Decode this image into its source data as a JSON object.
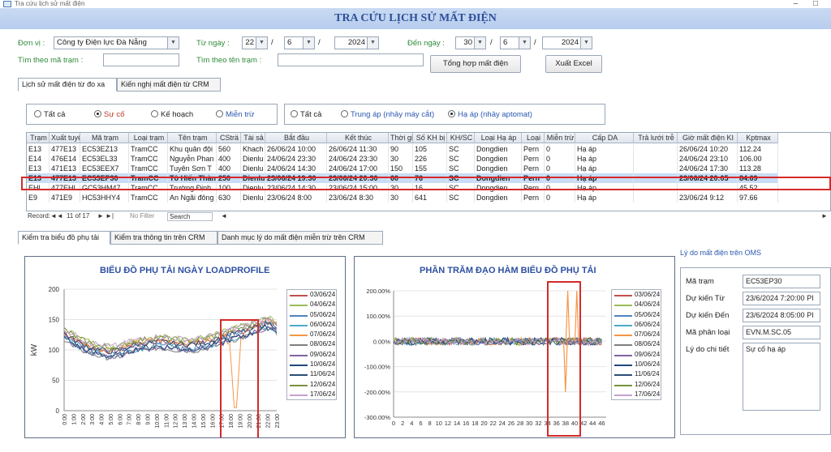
{
  "window": {
    "title": "Tra cứu lịch sử mất điện",
    "controls": "–  □"
  },
  "banner_title": "TRA CỨU LỊCH SỬ MẤT ĐIỆN",
  "filters": {
    "unit_label": "Đơn vị :",
    "unit_value": "Công ty Điện lực Đà Nẵng",
    "from_label": "Từ ngày :",
    "from_day": "22",
    "from_month": "6",
    "from_year": "2024",
    "to_label": "Đến ngày :",
    "to_day": "30",
    "to_month": "6",
    "to_year": "2024",
    "slash": "/",
    "search_code_label": "Tìm theo mã trạm :",
    "search_name_label": "Tìm theo tên trạm :",
    "search_code_value": "",
    "search_name_value": ""
  },
  "buttons": {
    "summary": "Tổng hợp mất điện",
    "export": "Xuất Excel"
  },
  "top_tabs": [
    "Lịch sử mất điện từ đo xa",
    "Kiến nghị mất điện từ CRM"
  ],
  "radios_group1": [
    {
      "label": "Tất cả",
      "checked": false,
      "color": "#222222"
    },
    {
      "label": "Sự cố",
      "checked": true,
      "color": "#c0392b"
    },
    {
      "label": "Kế hoạch",
      "checked": false,
      "color": "#222222"
    },
    {
      "label": "Miễn trừ",
      "checked": false,
      "color": "#2a58b0"
    }
  ],
  "radios_group2": [
    {
      "label": "Tất cả",
      "checked": false,
      "color": "#222222"
    },
    {
      "label": "Trung áp (nhảy máy cắt)",
      "checked": false,
      "color": "#2a58b0"
    },
    {
      "label": "Hạ áp (nhảy aptomat)",
      "checked": true,
      "color": "#2a58b0"
    }
  ],
  "table": {
    "columns": [
      "Trạm",
      "Xuất tuyế",
      "Mã trạm",
      "Loại trạm",
      "Tên trạm",
      "CSträ",
      "Tài sả",
      "Bắt đầu",
      "Kết thúc",
      "Thời gi",
      "Số KH bị",
      "KH/SC",
      "Loại Hạ áp",
      "Loại",
      "Miễn trừ",
      "Cấp DA",
      "Trả lưới trễ",
      "Giờ mất điện KI",
      "Kptmax"
    ],
    "rows": [
      [
        "E13",
        "477E13",
        "EC53EZ13",
        "TramCC",
        "Khu quân đội",
        "560",
        "Khach",
        "26/06/24 10:00",
        "26/06/24 11:30",
        "90",
        "105",
        "SC",
        "Dongdien",
        "Pern",
        "0",
        "Hạ áp",
        "",
        "26/06/24 10:20",
        "112.24"
      ],
      [
        "E14",
        "476E14",
        "EC53EL33",
        "TramCC",
        "Nguyễn Phan",
        "400",
        "Dienlu",
        "24/06/24 23:30",
        "24/06/24 23:30",
        "30",
        "226",
        "SC",
        "Dongdien",
        "Pern",
        "0",
        "Hạ áp",
        "",
        "24/06/24 23:10",
        "106.00"
      ],
      [
        "E13",
        "471E13",
        "EC53EEX7",
        "TramCC",
        "Tuyên Sơn T",
        "400",
        "Dienlu",
        "24/06/24 14:30",
        "24/06/24 17:00",
        "150",
        "155",
        "SC",
        "Dongdien",
        "Pern",
        "0",
        "Hạ áp",
        "",
        "24/06/24 17:30",
        "113.28"
      ],
      [
        "E13",
        "477E13",
        "EC53EP30",
        "TramCC",
        "Tô Hiến Thàn",
        "250",
        "Dienlu",
        "23/06/24 19:30",
        "23/06/24 20:30",
        "60",
        "76",
        "SC",
        "Dongdien",
        "Pern",
        "0",
        "Hạ áp",
        "",
        "23/06/24 20:05",
        "84.69"
      ],
      [
        "EHL",
        "477EHL",
        "GC53HM47",
        "TramCC",
        "Trường Định",
        "100",
        "Dienlu",
        "23/06/24 14:30",
        "23/06/24 15:00",
        "30",
        "16",
        "SC",
        "Dongdien",
        "Pern",
        "0",
        "Hạ áp",
        "",
        "",
        "45.52"
      ],
      [
        "E9",
        "471E9",
        "HC53HHY4",
        "TramCC",
        "An Ngãi đông",
        "630",
        "Dienlu",
        "23/06/24 8:00",
        "23/06/24 8:30",
        "30",
        "641",
        "SC",
        "Dongdien",
        "Pern",
        "0",
        "Hạ áp",
        "",
        "23/06/24 9:12",
        "97.66"
      ]
    ],
    "selected_row": 3
  },
  "record_nav": {
    "label": "Record:",
    "position": "11 of 17",
    "filter": "No Filter",
    "search": "Search"
  },
  "bottom_tabs": [
    "Kiểm tra biểu đồ phụ tải",
    "Kiểm tra thông tin trên CRM",
    "Danh mục lý do mất điện miễn trừ trên CRM"
  ],
  "legend_dates": [
    "03/06/24",
    "04/06/24",
    "05/06/24",
    "06/06/24",
    "07/06/24",
    "08/06/24",
    "09/06/24",
    "10/06/24",
    "11/06/24",
    "12/06/24",
    "17/06/24"
  ],
  "series_colors": [
    "#c0504d",
    "#9bbb59",
    "#4f81bd",
    "#4bacc6",
    "#f79646",
    "#7f7f7f",
    "#8064a2",
    "#1f497d",
    "#2c4d75",
    "#77933c",
    "#c6a0d0"
  ],
  "chart_data": [
    {
      "type": "line",
      "title": "BIỂU ĐỒ PHỤ TẢI NGÀY LOADPROFILE",
      "ylabel": "kW",
      "ylim": [
        0,
        200
      ],
      "yticks": [
        0,
        50,
        100,
        150,
        200
      ],
      "x": [
        "0:00",
        "1:00",
        "2:00",
        "3:00",
        "4:00",
        "5:00",
        "6:00",
        "7:00",
        "8:00",
        "9:00",
        "10:00",
        "11:00",
        "12:00",
        "13:00",
        "14:00",
        "15:00",
        "16:00",
        "17:00",
        "18:00",
        "19:00",
        "20:00",
        "21:00",
        "22:00",
        "23:00"
      ],
      "series_count": 11,
      "typical_profile": [
        128,
        118,
        110,
        104,
        100,
        98,
        100,
        106,
        110,
        112,
        114,
        113,
        111,
        110,
        110,
        112,
        116,
        120,
        126,
        130,
        134,
        140,
        145,
        140
      ],
      "outage": {
        "series": "07/06/24",
        "values": [
          126,
          110,
          60,
          5,
          60,
          120
        ]
      }
    },
    {
      "type": "line",
      "title": "PHẦN TRĂM ĐẠO HÀM BIỂU ĐỒ PHỤ TẢI",
      "ylim": [
        -300,
        200
      ],
      "yticks": [
        "200.00%",
        "100.00%",
        "0.00%",
        "-100.00%",
        "-200.00%",
        "-300.00%"
      ],
      "x": [
        "0",
        "2",
        "4",
        "6",
        "8",
        "10",
        "12",
        "14",
        "16",
        "18",
        "20",
        "22",
        "24",
        "26",
        "28",
        "30",
        "32",
        "34",
        "36",
        "38",
        "40",
        "42",
        "44",
        "46"
      ],
      "series_count": 11,
      "baseline": 0,
      "spikes": [
        {
          "series": "07/06/24",
          "x": 38,
          "y": -200
        },
        {
          "series": "07/06/24",
          "x": 38.5,
          "y": 200
        },
        {
          "series": "07/06/24",
          "x": 40.5,
          "y": 200
        }
      ]
    }
  ],
  "oms": {
    "section_title": "Lý do mất điện trên OMS",
    "station_label": "Mã trạm",
    "station_value": "EC53EP30",
    "from_label": "Dự kiến Từ",
    "from_value": "23/6/2024 7:20:00 PI",
    "to_label": "Dự kiến Đến",
    "to_value": "23/6/2024 8:05:00 PI",
    "class_label": "Mã phân loại",
    "class_value": "EVN.M.SC.05",
    "detail_label": "Lý do chi tiết",
    "detail_value": "Sự cố hạ áp"
  }
}
